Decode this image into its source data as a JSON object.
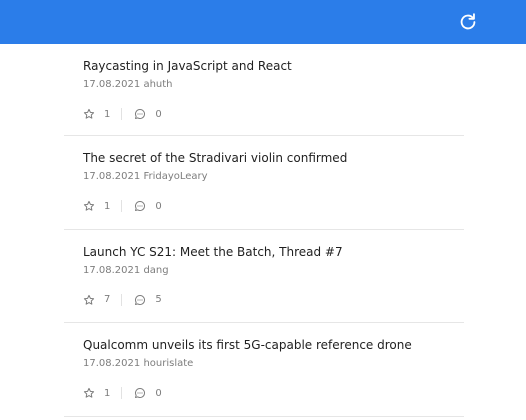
{
  "header": {
    "colors": {
      "bar": "#2b7de9",
      "icon": "#ffffff"
    },
    "refresh_icon": "refresh-icon"
  },
  "stories": [
    {
      "title": "Raycasting in JavaScript and React",
      "date": "17.08.2021",
      "author": "ahuth",
      "points": "1",
      "comments": "0"
    },
    {
      "title": "The secret of the Stradivari violin confirmed",
      "date": "17.08.2021",
      "author": "FridayoLeary",
      "points": "1",
      "comments": "0"
    },
    {
      "title": "Launch YC S21: Meet the Batch, Thread #7",
      "date": "17.08.2021",
      "author": "dang",
      "points": "7",
      "comments": "5"
    },
    {
      "title": "Qualcomm unveils its first 5G-capable reference drone",
      "date": "17.08.2021",
      "author": "hourislate",
      "points": "1",
      "comments": "0"
    }
  ],
  "icons": {
    "points": "star-icon",
    "comments": "comment-icon"
  }
}
